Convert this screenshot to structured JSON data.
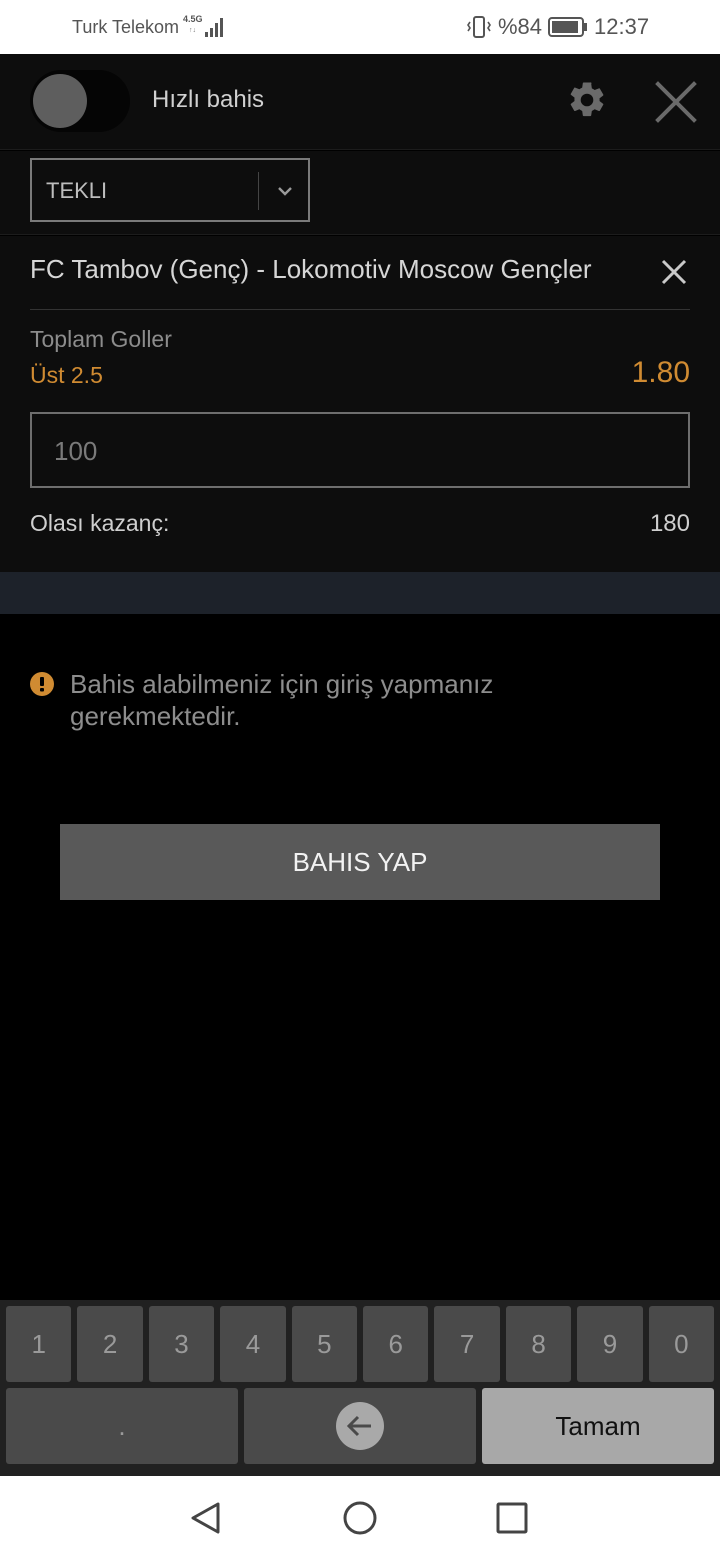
{
  "status_bar": {
    "carrier": "Turk Telekom",
    "network": "4.5G",
    "network_sub": "↑↓",
    "battery_percent": "%84",
    "time": "12:37"
  },
  "header": {
    "quickbet_label": "Hızlı bahis",
    "quickbet_enabled": false
  },
  "bet_type": {
    "selected": "TEKLI"
  },
  "bet": {
    "match": "FC Tambov (Genç) - Lokomotiv Moscow Gençler",
    "market": "Toplam Goller",
    "selection": "Üst 2.5",
    "odds": "1.80",
    "stake": "100",
    "winnings_label": "Olası kazanç:",
    "winnings_value": "180"
  },
  "warning": {
    "text": "Bahis alabilmeniz için giriş yapmanız gerekmektedir."
  },
  "place_bet_label": "BAHIS YAP",
  "keyboard": {
    "digits": [
      "1",
      "2",
      "3",
      "4",
      "5",
      "6",
      "7",
      "8",
      "9",
      "0"
    ],
    "decimal": ".",
    "done": "Tamam"
  },
  "colors": {
    "accent": "#d08b32",
    "background": "#000000",
    "panel": "#0d0d0d",
    "band": "#1d222a"
  },
  "icons": [
    "gear-icon",
    "close-icon",
    "chevron-down-icon",
    "remove-icon",
    "warning-icon",
    "backspace-icon",
    "nav-back-icon",
    "nav-home-icon",
    "nav-recent-icon"
  ]
}
